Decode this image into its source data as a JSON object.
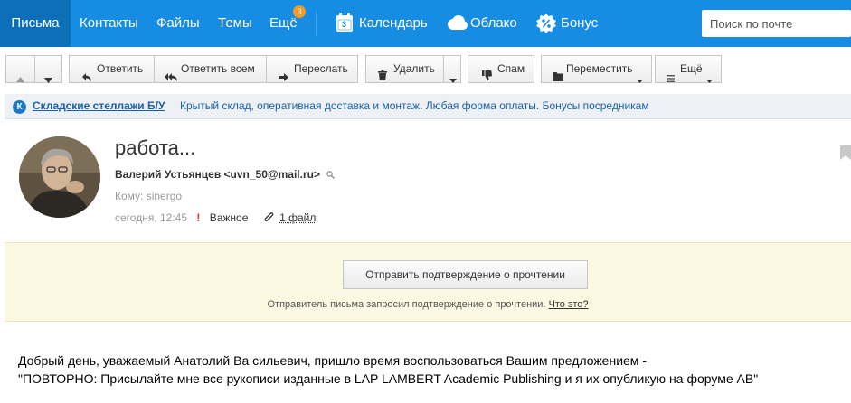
{
  "nav": {
    "mail": "Письма",
    "contacts": "Контакты",
    "files": "Файлы",
    "themes": "Темы",
    "more": "Ещё",
    "more_badge": "3",
    "calendar": "Календарь",
    "calendar_day": "3",
    "cloud": "Облако",
    "bonus": "Бонус",
    "search_placeholder": "Поиск по почте"
  },
  "toolbar": {
    "reply": "Ответить",
    "reply_all": "Ответить всем",
    "forward": "Переслать",
    "delete": "Удалить",
    "spam": "Спам",
    "move": "Переместить",
    "more": "Ещё"
  },
  "ad": {
    "logo_letter": "К",
    "title": "Складские стеллажи Б/У",
    "text": "Крытый склад, оперативная доставка и монтаж. Любая форма оплаты. Бонусы посредникам"
  },
  "message": {
    "subject": "работа...",
    "sender": "Валерий Устьянцев <uvn_50@mail.ru>",
    "to": "Кому: sinergo",
    "date": "сегодня, 12:45",
    "important_mark": "!",
    "important_label": "Важное",
    "files": "1 файл"
  },
  "confirm": {
    "button": "Отправить подтверждение о прочтении",
    "note": "Отправитель письма запросил подтверждение о прочтении.",
    "link": "Что это?"
  },
  "body": {
    "line1": "Добрый день, уважаемый Анатолий Ва сильевич, пришло время воспользоваться Вашим предложением -",
    "line2": "\"ПОВТОРНО: Присылайте мне все рукописи изданные в LAP LAMBERT Academic Publishing и я их опубликую на форуме АВ\""
  },
  "colors": {
    "topbar": "#168de2",
    "active_tab": "#0d6fb8",
    "badge": "#f59a23",
    "link": "#1a5fa8",
    "confirm_bg": "#fcf9e3"
  },
  "icons": [
    "calendar-icon",
    "cloud-icon",
    "bonus-percent-icon",
    "arrow-up-icon",
    "arrow-down-icon",
    "reply-icon",
    "reply-all-icon",
    "forward-icon",
    "trash-icon",
    "dropdown-arrow-icon",
    "thumbs-down-icon",
    "folder-icon",
    "menu-lines-icon",
    "search-small-icon",
    "paperclip-icon",
    "bookmark-flag-icon"
  ]
}
